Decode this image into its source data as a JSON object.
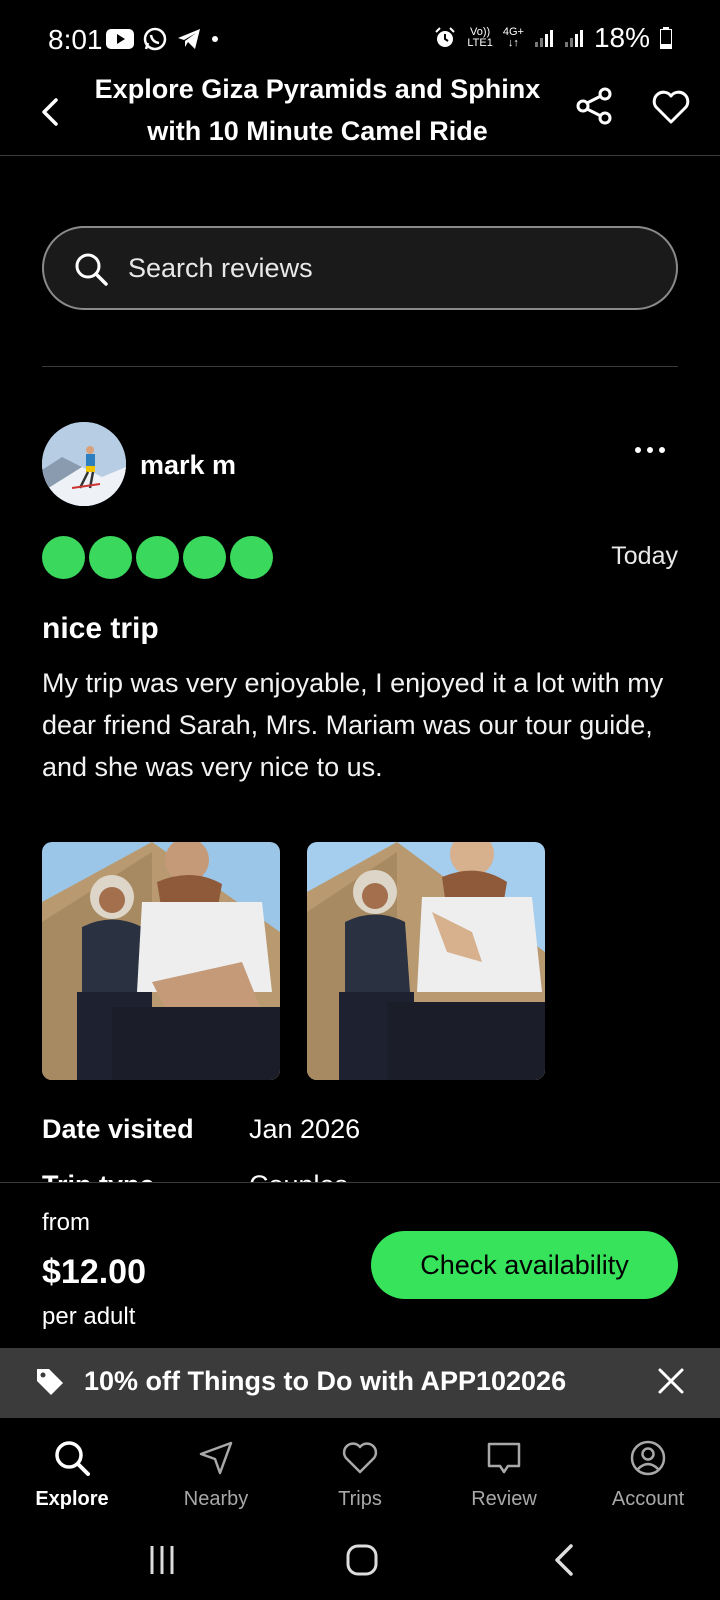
{
  "status_bar": {
    "time": "8:01",
    "battery": "18%",
    "network_top": "Vo))",
    "network_bottom": "LTE1",
    "network2_top": "4G+",
    "network2_bottom": "↓↑"
  },
  "header": {
    "title": "Explore Giza Pyramids and Sphinx with 10 Minute Camel Ride"
  },
  "search": {
    "placeholder": "Search reviews"
  },
  "review": {
    "reviewer": "mark m",
    "rating": 5,
    "date": "Today",
    "title": "nice trip",
    "text": "My trip was very enjoyable, I enjoyed it a lot with my dear friend Sarah, Mrs. Mariam was our tour guide, and she was very nice to us.",
    "date_visited_label": "Date visited",
    "date_visited": "Jan 2026",
    "trip_type_label": "Trip type",
    "trip_type": "Couples"
  },
  "booking": {
    "from": "from",
    "price": "$12.00",
    "per": "per adult",
    "cta": "Check availability"
  },
  "promo": {
    "text": "10% off Things to Do with APP102026"
  },
  "nav": {
    "items": [
      {
        "label": "Explore",
        "icon": "search-icon"
      },
      {
        "label": "Nearby",
        "icon": "navigation-icon"
      },
      {
        "label": "Trips",
        "icon": "heart-icon"
      },
      {
        "label": "Review",
        "icon": "review-icon"
      },
      {
        "label": "Account",
        "icon": "account-icon"
      }
    ]
  },
  "colors": {
    "accent": "#37e35a",
    "background": "#000000",
    "promo_bg": "#3b3b3b"
  }
}
